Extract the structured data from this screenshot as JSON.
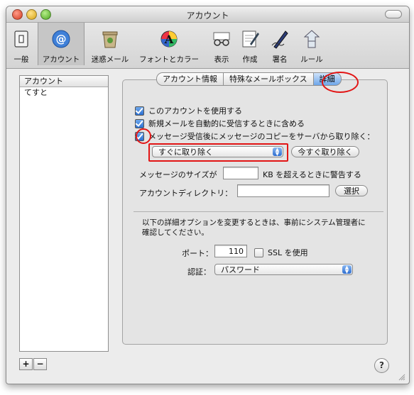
{
  "window": {
    "title": "アカウント"
  },
  "toolbar": {
    "items": [
      {
        "label": "一般",
        "icon": "switch-icon"
      },
      {
        "label": "アカウント",
        "icon": "at-sign-icon",
        "selected": true
      },
      {
        "label": "迷惑メール",
        "icon": "junk-mail-icon"
      },
      {
        "label": "フォントとカラー",
        "icon": "fonts-colors-icon"
      },
      {
        "label": "表示",
        "icon": "view-glasses-icon"
      },
      {
        "label": "作成",
        "icon": "compose-icon"
      },
      {
        "label": "署名",
        "icon": "signature-pen-icon"
      },
      {
        "label": "ルール",
        "icon": "rules-icon"
      }
    ]
  },
  "accounts": {
    "header": "アカウント",
    "items": [
      "てすと"
    ],
    "add_label": "+",
    "remove_label": "−"
  },
  "tabs": [
    {
      "label": "アカウント情報"
    },
    {
      "label": "特殊なメールボックス"
    },
    {
      "label": "詳細",
      "active": true
    }
  ],
  "advanced": {
    "checkbox_enable": "このアカウントを使用する",
    "checkbox_autocheck": "新規メールを自動的に受信するときに含める",
    "checkbox_remove": "メッセージ受信後にメッセージのコピーをサーバから取り除く：",
    "remove_option": "すぐに取り除く",
    "remove_now_button": "今すぐ取り除く",
    "size_warning_prefix": "メッセージのサイズが",
    "size_warning_value": "",
    "size_warning_suffix": "KB を超えるときに警告する",
    "directory_label": "アカウントディレクトリ：",
    "directory_value": "",
    "choose_button": "選択",
    "admin_note": "以下の詳細オプションを変更するときは、事前にシステム管理者に確認してください。",
    "port_label": "ポート：",
    "port_value": "110",
    "ssl_label": "SSL を使用",
    "auth_label": "認証：",
    "auth_value": "パスワード"
  },
  "help": {
    "label": "?"
  },
  "colors": {
    "highlight": "#e21515",
    "accent": "#2e6ed0"
  }
}
